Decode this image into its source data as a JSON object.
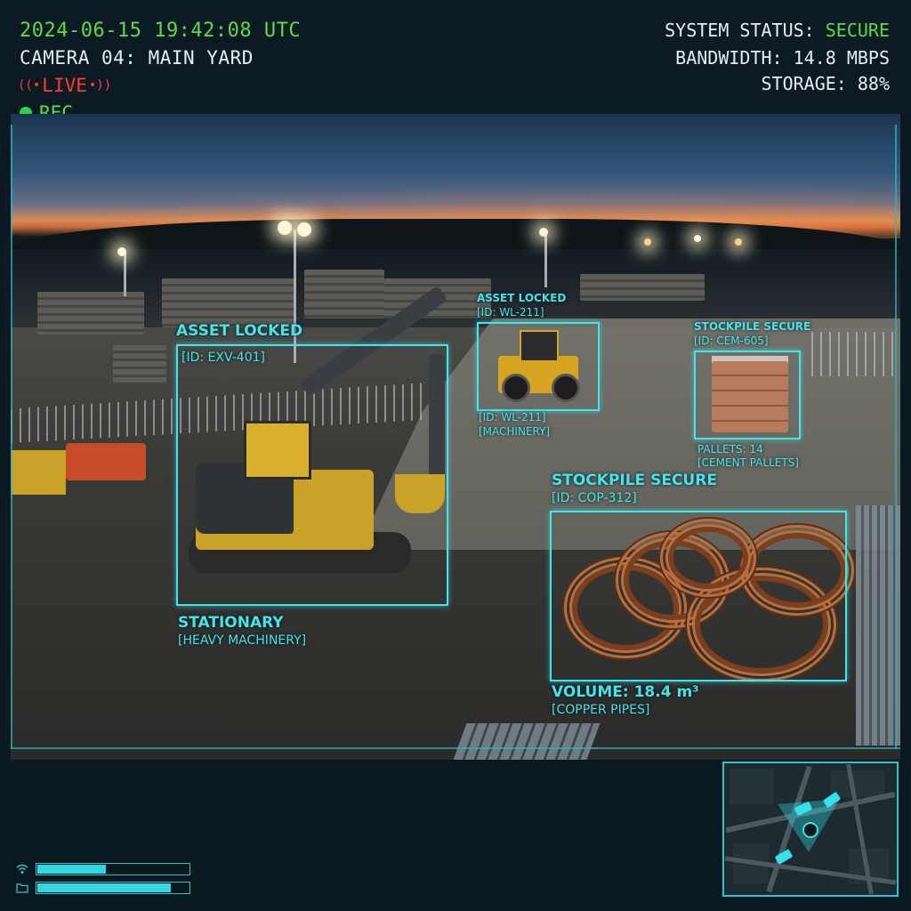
{
  "hud": {
    "timestamp": "2024-06-15 19:42:08 UTC",
    "camera": "CAMERA 04: MAIN YARD",
    "live_label": "LIVE",
    "rec_label": "REC",
    "system_status_label": "SYSTEM STATUS:",
    "system_status_value": "SECURE",
    "bandwidth": "BANDWIDTH: 14.8 MBPS",
    "storage": "STORAGE: 88%"
  },
  "detections": {
    "excavator": {
      "status": "ASSET LOCKED",
      "id": "[ID: EXV-401]",
      "state": "STATIONARY",
      "category": "[HEAVY MACHINERY]"
    },
    "loader": {
      "status": "ASSET LOCKED",
      "id_top": "[ID: WL-211]",
      "id_bottom": "[ID: WL-211]",
      "category": "[MACHINERY]"
    },
    "cement": {
      "status": "STOCKPILE SECURE",
      "id": "[ID: CEM-605]",
      "count": "PALLETS: 14",
      "category": "[CEMENT PALLETS]"
    },
    "copper": {
      "status": "STOCKPILE SECURE",
      "id": "[ID: COP-312]",
      "volume": "VOLUME: 18.4 m³",
      "category": "[COPPER PIPES]"
    }
  },
  "bottom_bars": [
    {
      "icon": "wifi-signal-icon",
      "level": 0.45
    },
    {
      "icon": "folder-icon",
      "level": 0.88
    }
  ],
  "colors": {
    "accent_cyan": "#3ee6ee",
    "status_green": "#5fd94a",
    "live_red": "#ff3b30"
  }
}
